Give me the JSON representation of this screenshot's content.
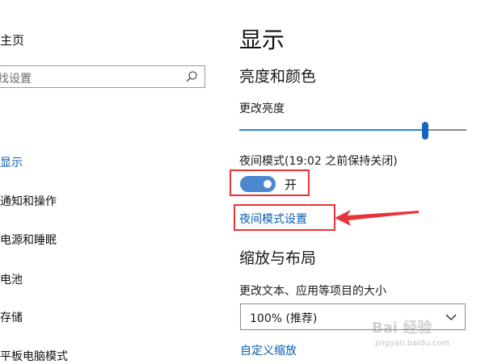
{
  "sidebar": {
    "home_label": "主页",
    "search_placeholder": "找设置",
    "items": [
      {
        "label": "显示",
        "active": true
      },
      {
        "label": "通知和操作"
      },
      {
        "label": "电源和睡眠"
      },
      {
        "label": "电池"
      },
      {
        "label": "存储"
      },
      {
        "label": "平板电脑模式"
      }
    ]
  },
  "main": {
    "title": "显示",
    "brightness_section": "亮度和颜色",
    "brightness_label": "更改亮度",
    "brightness_value": 0.82,
    "night_light_label": "夜间模式(19:02 之前保持关闭)",
    "night_light_state": "开",
    "night_light_settings_link": "夜间模式设置",
    "scale_section": "缩放与布局",
    "scale_label": "更改文本、应用等项目的大小",
    "scale_value": "100% (推荐)",
    "custom_scale_link": "自定义缩放"
  },
  "watermark": {
    "text": "Bai 经验",
    "sub": "jingyan.baidu.com"
  },
  "colors": {
    "accent": "#0b5cad",
    "toggle_on": "#4b88cf",
    "annotation": "#e6353a"
  }
}
